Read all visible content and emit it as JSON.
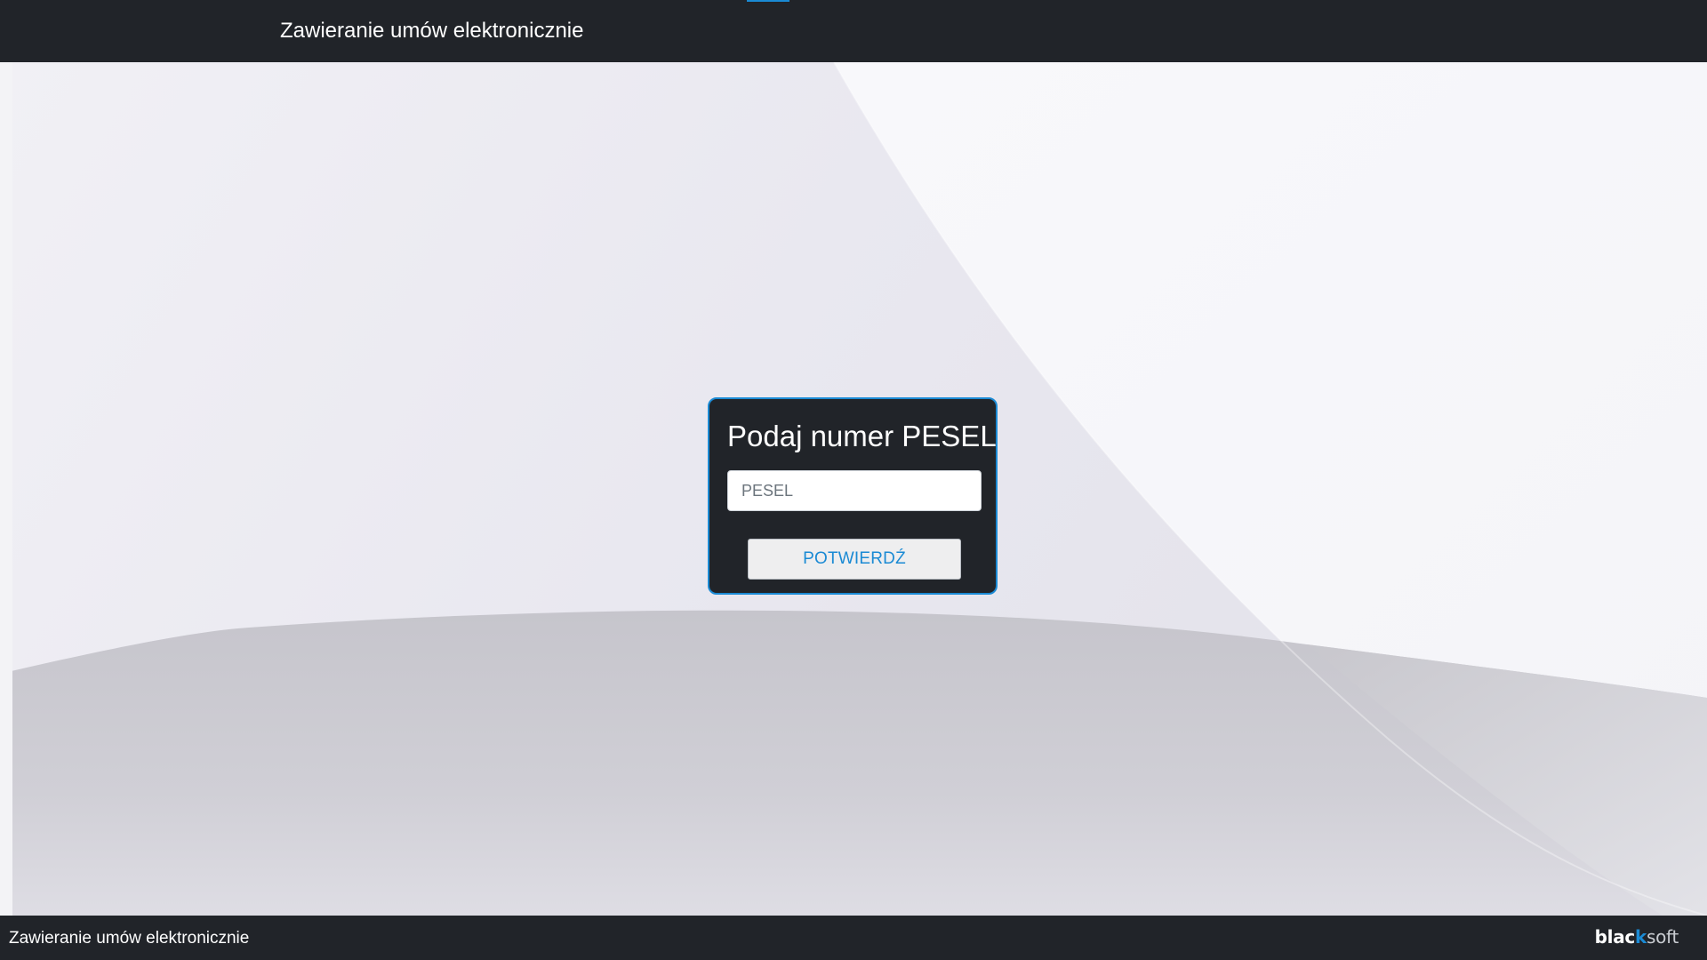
{
  "header": {
    "title": "Zawieranie umów elektronicznie"
  },
  "form": {
    "heading": "Podaj numer PESEL",
    "pesel_placeholder": "PESEL",
    "pesel_value": "",
    "confirm_label": "POTWIERDŹ"
  },
  "footer": {
    "text": "Zawieranie umów elektronicznie",
    "logo": {
      "part1": "blac",
      "part2": "k",
      "part3": "soft"
    }
  },
  "colors": {
    "bar_background": "#212429",
    "accent": "#1a8ad4",
    "button_text": "#1a8ad4"
  }
}
